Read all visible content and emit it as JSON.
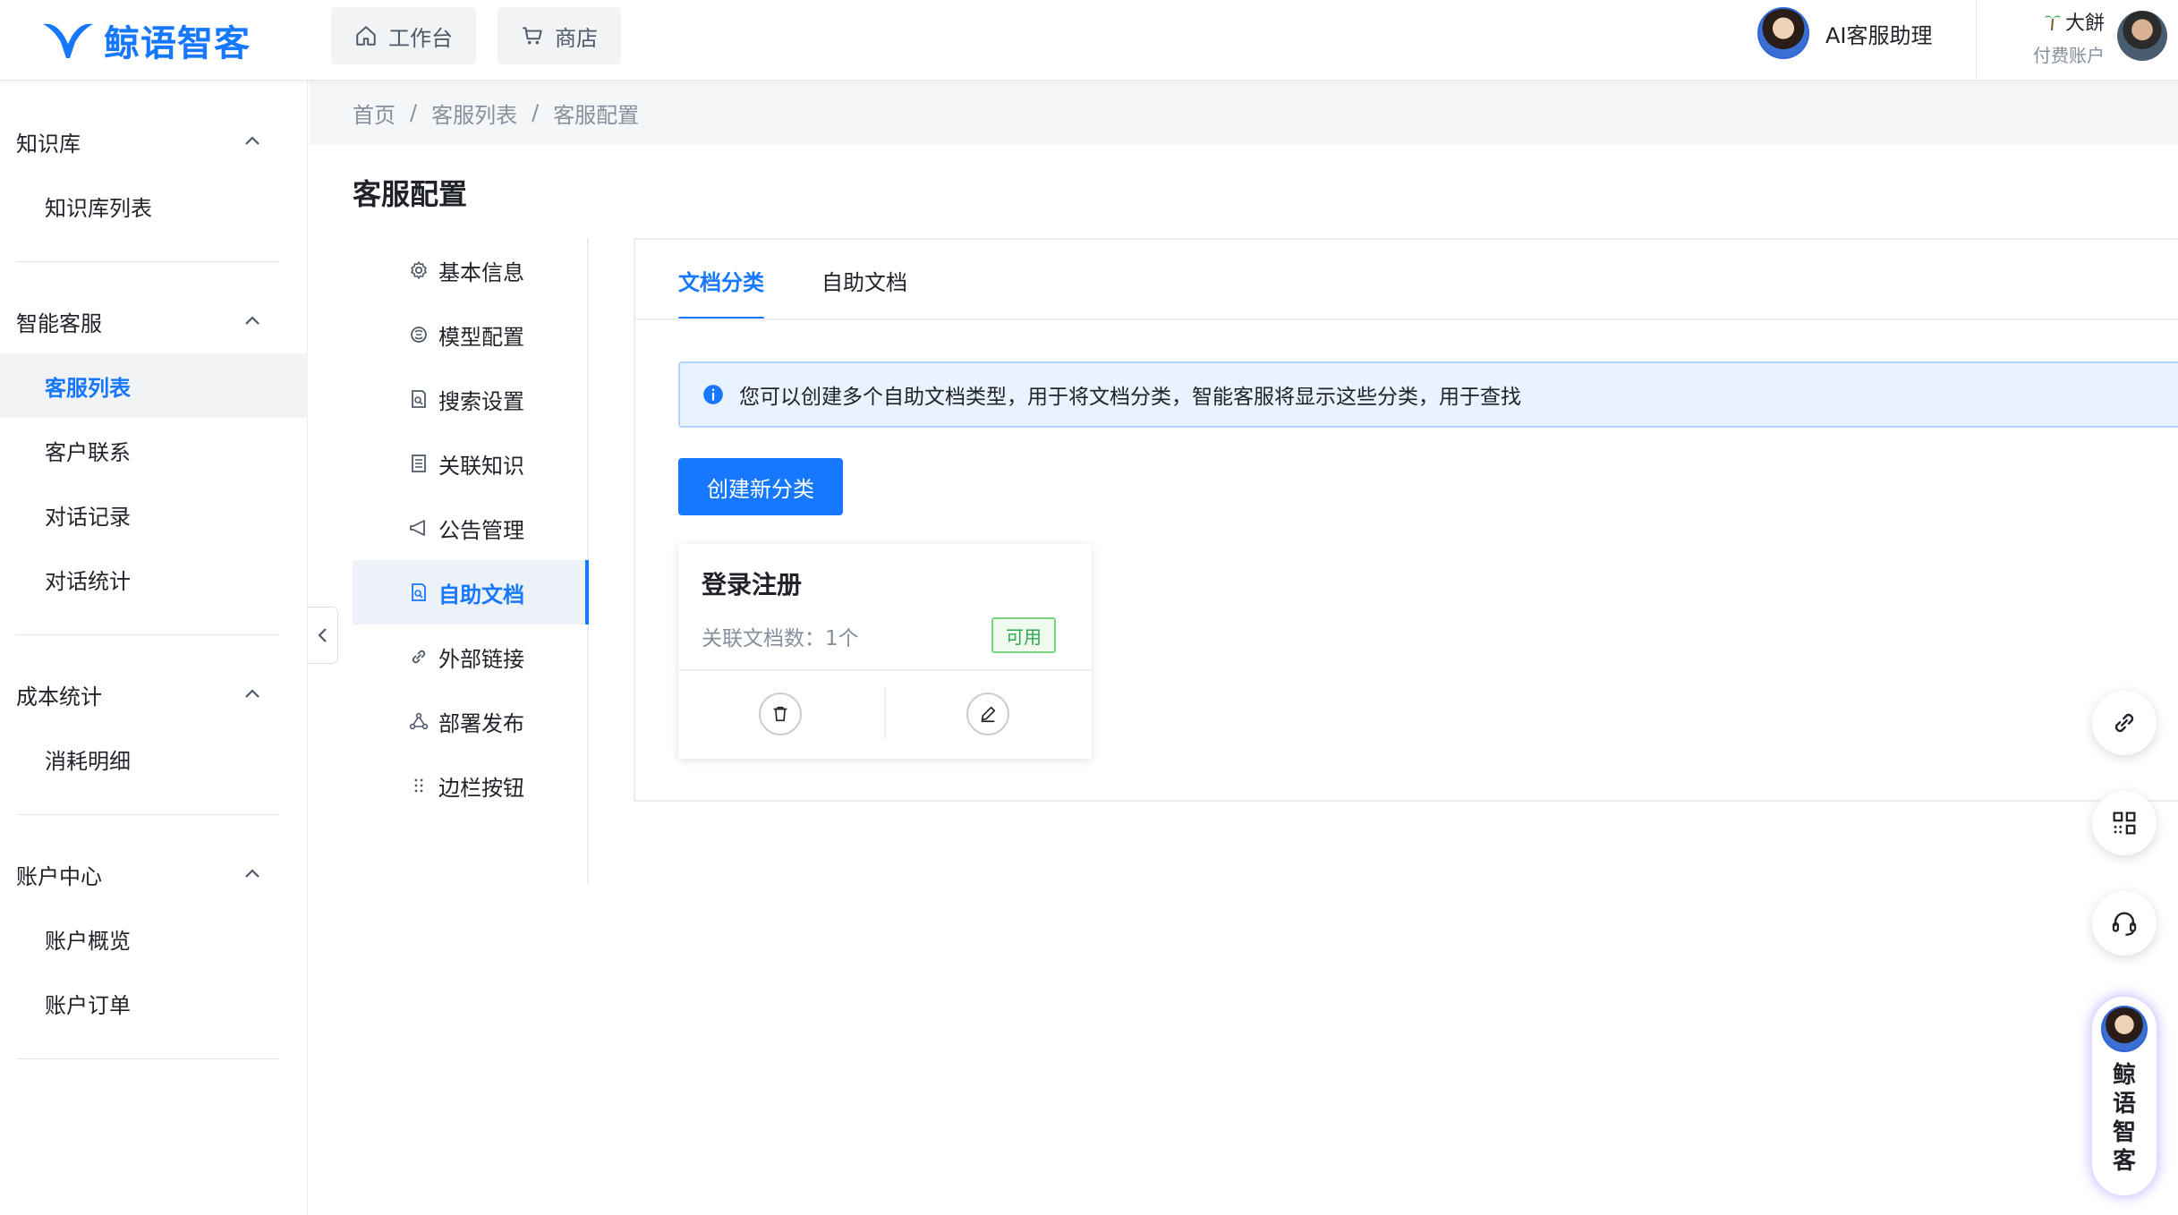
{
  "brand": {
    "name": "鲸语智客",
    "color": "#1677ff"
  },
  "topbar": {
    "tabs": [
      {
        "label": "工作台",
        "icon": "home-icon"
      },
      {
        "label": "商店",
        "icon": "cart-icon"
      }
    ],
    "assistant_label": "AI客服助理",
    "user": {
      "name": "大餅",
      "plan": "付费账户"
    }
  },
  "sidebar": {
    "groups": [
      {
        "title": "知识库",
        "items": [
          {
            "label": "知识库列表"
          }
        ]
      },
      {
        "title": "智能客服",
        "items": [
          {
            "label": "客服列表",
            "active": true
          },
          {
            "label": "客户联系"
          },
          {
            "label": "对话记录"
          },
          {
            "label": "对话统计"
          }
        ]
      },
      {
        "title": "成本统计",
        "items": [
          {
            "label": "消耗明细"
          }
        ]
      },
      {
        "title": "账户中心",
        "items": [
          {
            "label": "账户概览"
          },
          {
            "label": "账户订单"
          }
        ]
      }
    ]
  },
  "breadcrumb": [
    "首页",
    "/",
    "客服列表",
    "/",
    "客服配置"
  ],
  "page_title": "客服配置",
  "subnav": [
    {
      "label": "基本信息",
      "icon": "gear-icon"
    },
    {
      "label": "模型配置",
      "icon": "model-icon"
    },
    {
      "label": "搜索设置",
      "icon": "search-doc-icon"
    },
    {
      "label": "关联知识",
      "icon": "book-icon"
    },
    {
      "label": "公告管理",
      "icon": "megaphone-icon"
    },
    {
      "label": "自助文档",
      "icon": "doc-search-icon",
      "active": true
    },
    {
      "label": "外部链接",
      "icon": "link-icon"
    },
    {
      "label": "部署发布",
      "icon": "deploy-icon"
    },
    {
      "label": "边栏按钮",
      "icon": "dots-icon"
    }
  ],
  "tabs": [
    {
      "label": "文档分类",
      "active": true
    },
    {
      "label": "自助文档"
    }
  ],
  "alert": "您可以创建多个自助文档类型，用于将文档分类，智能客服将显示这些分类，用于查找",
  "create_button": "创建新分类",
  "category_card": {
    "title": "登录注册",
    "count_label": "关联文档数：1个",
    "status": "可用",
    "actions": [
      "delete-icon",
      "edit-icon"
    ]
  },
  "float_buttons": [
    "link-icon",
    "qrcode-icon",
    "headset-icon"
  ],
  "brand_pill_chars": [
    "鲸",
    "语",
    "智",
    "客"
  ]
}
